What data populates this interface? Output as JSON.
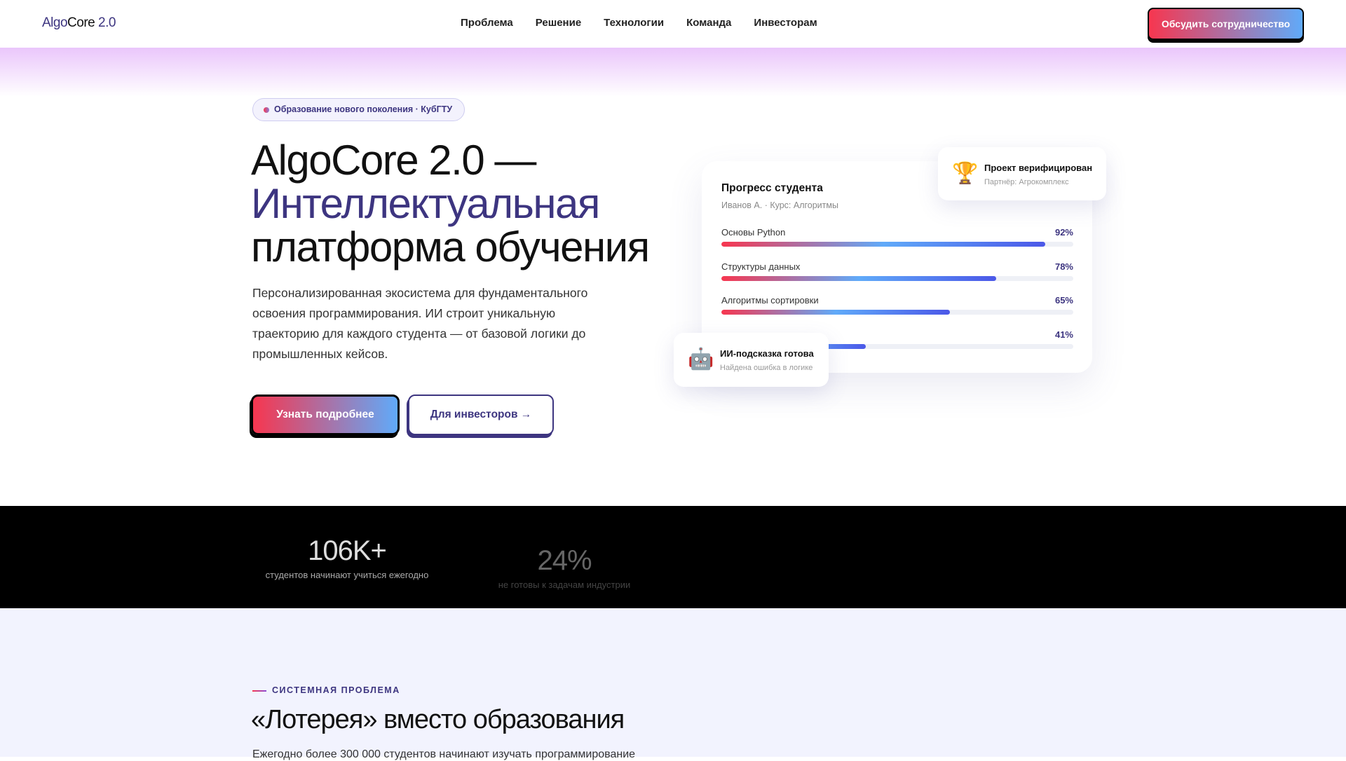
{
  "nav": {
    "logo": {
      "part1": "Algo",
      "part2": "Core",
      "part3": " 2.0"
    },
    "links": [
      "Проблема",
      "Решение",
      "Технологии",
      "Команда",
      "Инвесторам"
    ],
    "cta": "Обсудить сотрудничество"
  },
  "hero": {
    "badge": "Образование нового поколения · КубГТУ",
    "title_line1": "AlgoCore 2.0 —",
    "title_accent": "Интеллектуальная",
    "title_line3": "платформа обучения",
    "lead": "Персонализированная экосистема для фундаментального освоения программирования. ИИ строит уникальную траекторию для каждого студента — от базовой логики до промышленных кейсов.",
    "btn_primary": "Узнать подробнее",
    "btn_secondary": "Для инвесторов →"
  },
  "progress_card": {
    "title": "Прогресс студента",
    "subtitle": "Иванов А. · Курс: Алгоритмы",
    "items": [
      {
        "label": "Основы Python",
        "percent": 92,
        "text": "92%"
      },
      {
        "label": "Структуры данных",
        "percent": 78,
        "text": "78%"
      },
      {
        "label": "Алгоритмы сортировки",
        "percent": 65,
        "text": "65%"
      },
      {
        "label": "",
        "percent": 41,
        "text": "41%"
      }
    ]
  },
  "verified": {
    "icon": "trophy-icon",
    "title": "Проект верифицирован",
    "subtitle": "Партнёр: Агрокомплекс"
  },
  "ai_hint": {
    "icon": "robot-icon",
    "title": "ИИ-подсказка готова",
    "subtitle": "Найдена ошибка в логике"
  },
  "stats": [
    {
      "value": "106K+",
      "desc": "студентов начинают учиться ежегодно"
    },
    {
      "value": "24%",
      "desc": "не готовы к задачам индустрии"
    }
  ],
  "problem": {
    "kicker": "СИСТЕМНАЯ ПРОБЛЕМА",
    "title": "«Лотерея» вместо образования",
    "text": "Ежегодно более 300 000 студентов начинают изучать программирование"
  },
  "colors": {
    "accent": "#3d3580",
    "gradient_start": "#f7364f",
    "gradient_end": "#60aaf9"
  }
}
